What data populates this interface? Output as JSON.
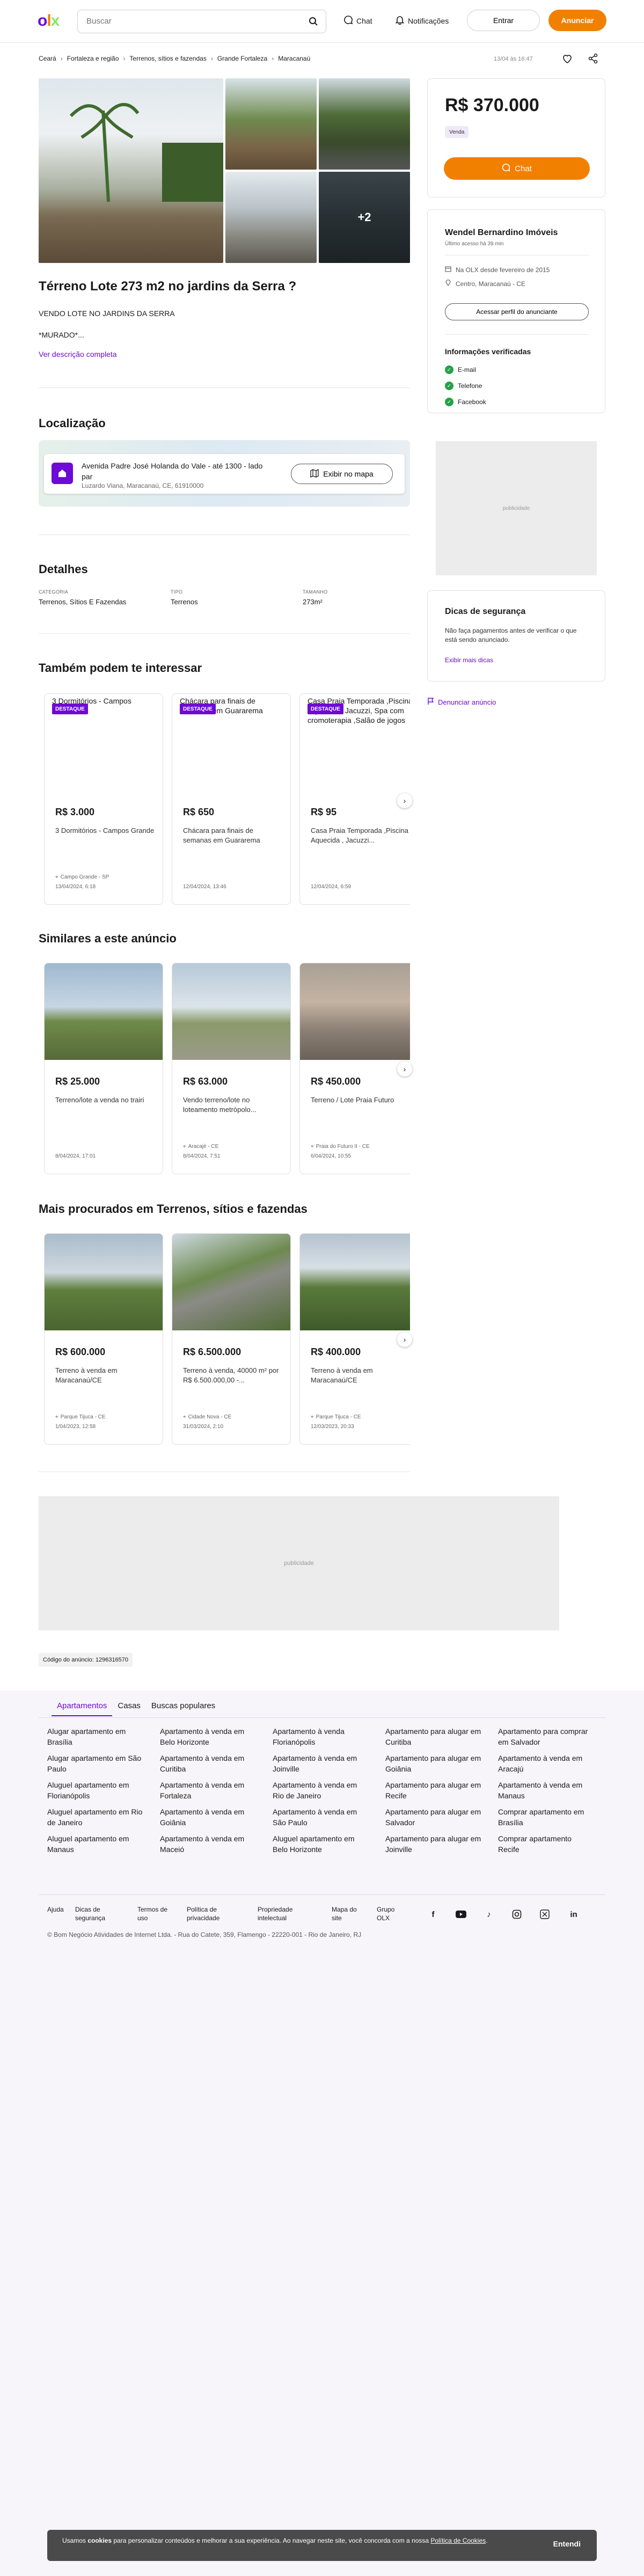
{
  "header": {
    "logo": "olx",
    "search_placeholder": "Buscar",
    "chat": "Chat",
    "notifications": "Notificações",
    "login": "Entrar",
    "advertise": "Anunciar"
  },
  "breadcrumb": [
    "Ceará",
    "Fortaleza e região",
    "Terrenos, sítios e fazendas",
    "Grande Fortaleza",
    "Maracanaú"
  ],
  "posted": "13/04 às 16:47",
  "gallery": {
    "more_count": "+2"
  },
  "listing": {
    "title": "Térreno Lote 273 m2 no jardins da Serra ?",
    "desc_line1": "VENDO LOTE NO JARDINS DA SERRA",
    "desc_line2": "*MURADO*...",
    "full_desc_link": "Ver descrição completa"
  },
  "location": {
    "heading": "Localização",
    "address": "Avenida Padre José Holanda do Vale - até 1300 - lado par",
    "sub": "Luzardo Viana, Maracanaú, CE, 61910000",
    "map_button": "Exibir no mapa"
  },
  "details": {
    "heading": "Detalhes",
    "items": [
      {
        "label": "CATEGORIA",
        "value": "Terrenos, Sítios E Fazendas"
      },
      {
        "label": "TIPO",
        "value": "Terrenos"
      },
      {
        "label": "TAMANHO",
        "value": "273m²"
      }
    ]
  },
  "price_card": {
    "price": "R$ 370.000",
    "badge": "Venda",
    "chat_button": "Chat"
  },
  "seller": {
    "name": "Wendel Bernardino Imóveis",
    "last_access": "Último acesso há 39 min",
    "since": "Na OLX desde fevereiro de 2015",
    "location": "Centro, Maracanaú - CE",
    "profile_button": "Acessar perfil do anunciante",
    "verified_heading": "Informações verificadas",
    "verified": [
      "E-mail",
      "Telefone",
      "Facebook"
    ]
  },
  "ad_label": "publicidade",
  "safety": {
    "heading": "Dicas de segurança",
    "text": "Não faça pagamentos antes de verificar o que está sendo anunciado.",
    "link": "Exibir mais dicas"
  },
  "report": "Denunciar anúncio",
  "interest": {
    "heading": "Também podem te interessar",
    "cards": [
      {
        "top_title": "3 Dormitórios - Campos Grande",
        "tag": "DESTAQUE",
        "price": "R$ 3.000",
        "title": "3 Dormitórios - Campos Grande",
        "loc": "Campo Grande - SP",
        "date": "13/04/2024, 6:18"
      },
      {
        "top_title": "Chácara para finais de semanas em Guararema",
        "tag": "DESTAQUE",
        "price": "R$ 650",
        "title": "Chácara para finais de semanas em Guararema",
        "loc": "",
        "date": "12/04/2024, 13:46"
      },
      {
        "top_title": "Casa Praia Temporada ,Piscina Aquecida , Jacuzzi, Spa com cromoterapia ,Salão de jogos",
        "tag": "DESTAQUE",
        "price": "R$ 95",
        "title": "Casa Praia Temporada ,Piscina Aquecida , Jacuzzi...",
        "loc": "",
        "date": "12/04/2024, 6:59"
      }
    ]
  },
  "similar": {
    "heading": "Similares a este anúncio",
    "cards": [
      {
        "price": "R$ 25.000",
        "title": "Terreno/lote a venda no trairi",
        "loc": "",
        "date": "8/04/2024, 17:01"
      },
      {
        "price": "R$ 63.000",
        "title": "Vendo terreno/lote no loteamento metrópolo...",
        "loc": "Aracajé - CE",
        "date": "8/04/2024, 7:51"
      },
      {
        "price": "R$ 450.000",
        "title": "Terreno / Lote Praia Futuro",
        "loc": "Praia do Futuro II - CE",
        "date": "6/04/2024, 10:55"
      }
    ]
  },
  "most_searched": {
    "heading": "Mais procurados em Terrenos, sítios e fazendas",
    "cards": [
      {
        "price": "R$ 600.000",
        "title": "Terreno à venda em Maracanaú/CE",
        "loc": "Parque Tijuca - CE",
        "date": "1/04/2023, 12:58"
      },
      {
        "price": "R$ 6.500.000",
        "title": "Terreno à venda, 40000 m² por R$ 6.500.000,00 -...",
        "loc": "Cidade Nova - CE",
        "date": "31/03/2024, 2:10"
      },
      {
        "price": "R$ 400.000",
        "title": "Terreno à venda em Maracanaú/CE",
        "loc": "Parque Tijuca - CE",
        "date": "12/03/2023, 20:33"
      }
    ]
  },
  "ad_code": "Código do anúncio: 1296316570",
  "footer": {
    "tabs": [
      "Apartamentos",
      "Casas",
      "Buscas populares"
    ],
    "links": [
      [
        "Alugar apartamento em Brasília",
        "Alugar apartamento em São Paulo",
        "Aluguel apartamento em Florianópolis",
        "Aluguel apartamento em Rio de Janeiro",
        "Aluguel apartamento em Manaus"
      ],
      [
        "Apartamento à venda em Belo Horizonte",
        "Apartamento à venda em Curitiba",
        "Apartamento à venda em Fortaleza",
        "Apartamento à venda em Goiânia",
        "Apartamento à venda em Maceió"
      ],
      [
        "Apartamento à venda Florianópolis",
        "Apartamento à venda em Joinville",
        "Apartamento à venda em Rio de Janeiro",
        "Apartamento à venda em São Paulo",
        "Aluguel apartamento em Belo Horizonte"
      ],
      [
        "Apartamento para alugar em Curitiba",
        "Apartamento para alugar em Goiânia",
        "Apartamento para alugar em Recife",
        "Apartamento para alugar em Salvador",
        "Apartamento para alugar em Joinville"
      ],
      [
        "Apartamento para comprar em Salvador",
        "Apartamento à venda em Aracajú",
        "Apartamento à venda em Manaus",
        "Comprar apartamento em Brasília",
        "Comprar apartamento Recife"
      ]
    ],
    "nav": [
      "Ajuda",
      "Dicas de segurança",
      "Termos de uso",
      "Política de privacidade",
      "Propriedade intelectual",
      "Mapa do site",
      "Grupo OLX"
    ],
    "copyright": "© Bom Negócio Atividades de Internet Ltda. - Rua do Catete, 359, Flamengo - 22220-001 - Rio de Janeiro, RJ"
  },
  "cookie": {
    "text_pre": "Usamos ",
    "text_bold": "cookies",
    "text_mid": " para personalizar conteúdos e melhorar a sua experiência. Ao navegar neste site, você concorda com a nossa ",
    "link": "Política de Cookies",
    "text_end": ".",
    "button": "Entendi"
  },
  "colors": {
    "purple": "#6e0ad6",
    "orange": "#f28000",
    "green": "#8ce563",
    "verified": "#24a148"
  }
}
